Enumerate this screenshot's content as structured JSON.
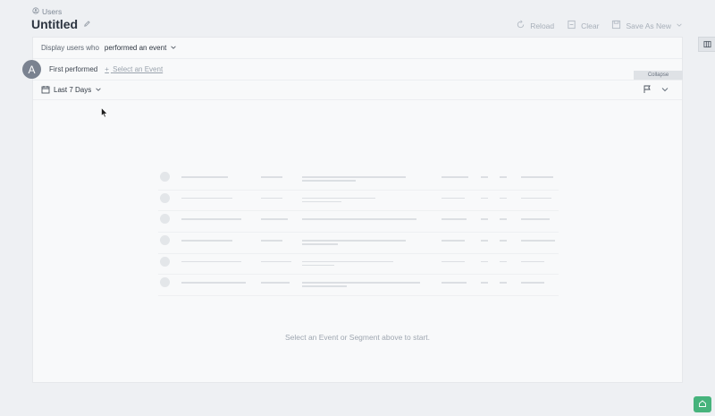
{
  "breadcrumb": {
    "label": "Users"
  },
  "page": {
    "title": "Untitled"
  },
  "toolbar": {
    "reload_label": "Reload",
    "clear_label": "Clear",
    "save_as_new_label": "Save As New"
  },
  "filter": {
    "prefix": "Display users who",
    "condition": "performed an event"
  },
  "event_row": {
    "avatar_letter": "A",
    "label": "First performed",
    "select_event_label": "Select an Event",
    "select_event_plus": "+"
  },
  "collapse_label": "Collapse",
  "date_range": {
    "selected": "Last 7 Days"
  },
  "empty_state": {
    "message": "Select an Event or Segment above to start."
  },
  "icons": {
    "breadcrumb": "users-icon",
    "edit": "pencil-icon",
    "reload": "reload-icon",
    "clear": "clear-icon",
    "save": "save-icon",
    "calendar": "calendar-icon",
    "flag": "flag-icon",
    "chevron": "chevron-down-icon",
    "side_panel": "columns-icon",
    "help": "home-icon"
  },
  "colors": {
    "background": "#eef0f3",
    "panel": "#f8f9fa",
    "avatar": "#7a8290",
    "help_button": "#46b37c",
    "muted_text": "#9fa7b1"
  }
}
